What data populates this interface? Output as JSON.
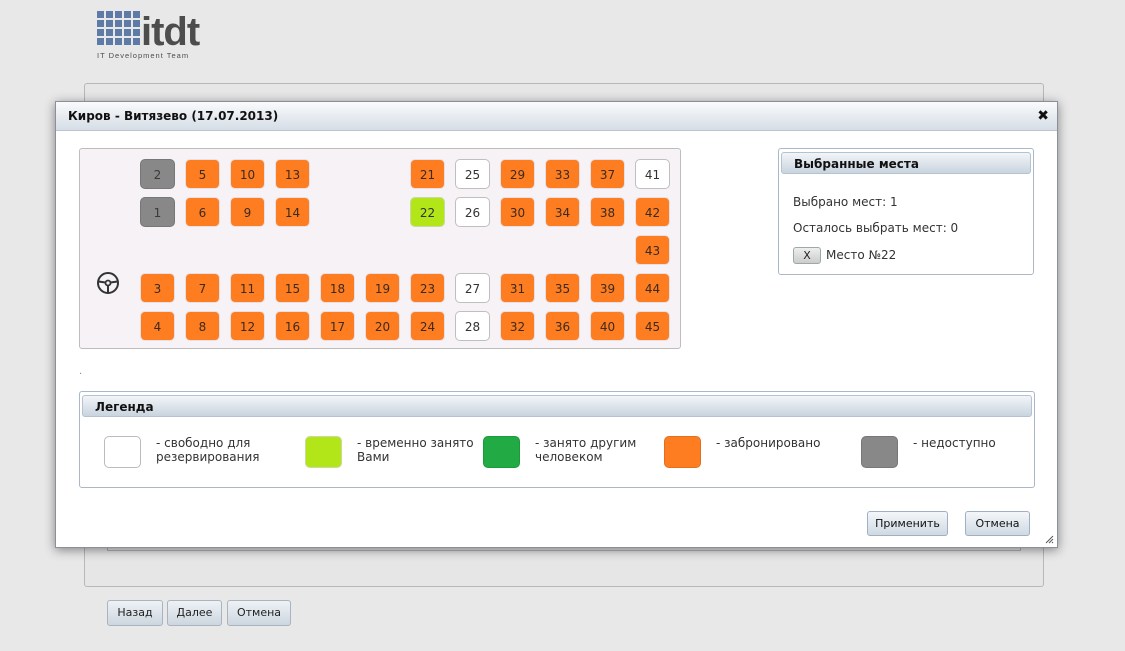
{
  "logo": {
    "text": "itdt",
    "subtitle": "IT Development Team"
  },
  "background": {
    "buttons": {
      "back": "Назад",
      "next": "Далее",
      "cancel": "Отмена"
    }
  },
  "dialog": {
    "title": "Киров - Витязево (17.07.2013)",
    "close_icon": "close-icon",
    "seats": [
      {
        "n": "2",
        "state": "unavailable"
      },
      {
        "n": "5",
        "state": "booked"
      },
      {
        "n": "10",
        "state": "booked"
      },
      {
        "n": "13",
        "state": "booked"
      },
      {
        "n": "21",
        "state": "booked"
      },
      {
        "n": "25",
        "state": "free"
      },
      {
        "n": "29",
        "state": "booked"
      },
      {
        "n": "33",
        "state": "booked"
      },
      {
        "n": "37",
        "state": "booked"
      },
      {
        "n": "41",
        "state": "free"
      },
      {
        "n": "1",
        "state": "unavailable"
      },
      {
        "n": "6",
        "state": "booked"
      },
      {
        "n": "9",
        "state": "booked"
      },
      {
        "n": "14",
        "state": "booked"
      },
      {
        "n": "22",
        "state": "selected"
      },
      {
        "n": "26",
        "state": "free"
      },
      {
        "n": "30",
        "state": "booked"
      },
      {
        "n": "34",
        "state": "booked"
      },
      {
        "n": "38",
        "state": "booked"
      },
      {
        "n": "42",
        "state": "booked"
      },
      {
        "n": "43",
        "state": "booked"
      },
      {
        "n": "3",
        "state": "booked"
      },
      {
        "n": "7",
        "state": "booked"
      },
      {
        "n": "11",
        "state": "booked"
      },
      {
        "n": "15",
        "state": "booked"
      },
      {
        "n": "18",
        "state": "booked"
      },
      {
        "n": "19",
        "state": "booked"
      },
      {
        "n": "23",
        "state": "booked"
      },
      {
        "n": "27",
        "state": "free"
      },
      {
        "n": "31",
        "state": "booked"
      },
      {
        "n": "35",
        "state": "booked"
      },
      {
        "n": "39",
        "state": "booked"
      },
      {
        "n": "44",
        "state": "booked"
      },
      {
        "n": "4",
        "state": "booked"
      },
      {
        "n": "8",
        "state": "booked"
      },
      {
        "n": "12",
        "state": "booked"
      },
      {
        "n": "16",
        "state": "booked"
      },
      {
        "n": "17",
        "state": "booked"
      },
      {
        "n": "20",
        "state": "booked"
      },
      {
        "n": "24",
        "state": "booked"
      },
      {
        "n": "28",
        "state": "free"
      },
      {
        "n": "32",
        "state": "booked"
      },
      {
        "n": "36",
        "state": "booked"
      },
      {
        "n": "40",
        "state": "booked"
      },
      {
        "n": "45",
        "state": "booked"
      }
    ],
    "dot": ".",
    "selected_panel": {
      "title": "Выбранные места",
      "selected_count": "Выбрано мест: 1",
      "remaining": "Осталось выбрать мест: 0",
      "remove_label": "X",
      "seat_label": "Место №22"
    },
    "legend": {
      "title": "Легенда",
      "items": [
        {
          "label": "- свободно для резервирования",
          "color": "#ffffff"
        },
        {
          "label": "- временно занято Вами",
          "color": "#b3e619"
        },
        {
          "label": "- занято другим человеком",
          "color": "#22aa44"
        },
        {
          "label": "- забронировано",
          "color": "#ff7d21"
        },
        {
          "label": "- недоступно",
          "color": "#888888"
        }
      ]
    },
    "buttons": {
      "apply": "Применить",
      "cancel": "Отмена"
    }
  }
}
